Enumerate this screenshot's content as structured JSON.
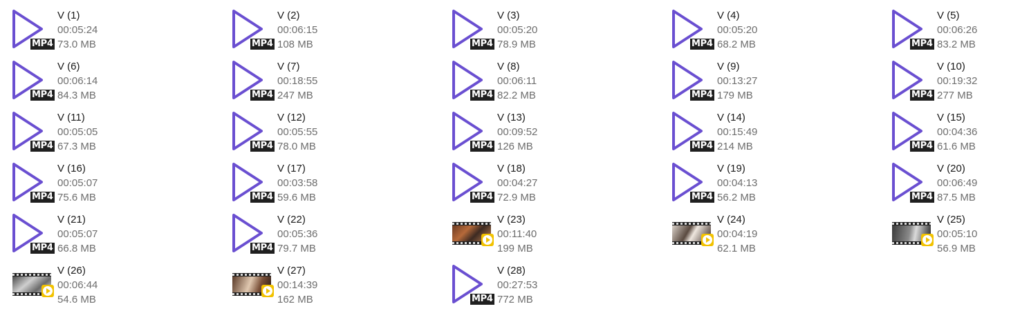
{
  "theme": {
    "mp4_icon_color": "#6a4fd1",
    "badge_background": "#1f1f1f",
    "play_badge_color": "#f2c200",
    "name_color": "#1a1a1a",
    "detail_color": "#6d6d6d"
  },
  "files": [
    {
      "name": "V (1)",
      "duration": "00:05:24",
      "size": "73.0 MB",
      "icon": "mp4-play-icon",
      "badge": "MP4"
    },
    {
      "name": "V (2)",
      "duration": "00:06:15",
      "size": "108 MB",
      "icon": "mp4-play-icon",
      "badge": "MP4"
    },
    {
      "name": "V (3)",
      "duration": "00:05:20",
      "size": "78.9 MB",
      "icon": "mp4-play-icon",
      "badge": "MP4"
    },
    {
      "name": "V (4)",
      "duration": "00:05:20",
      "size": "68.2 MB",
      "icon": "mp4-play-icon",
      "badge": "MP4"
    },
    {
      "name": "V (5)",
      "duration": "00:06:26",
      "size": "83.2 MB",
      "icon": "mp4-play-icon",
      "badge": "MP4"
    },
    {
      "name": "V (6)",
      "duration": "00:06:14",
      "size": "84.3 MB",
      "icon": "mp4-play-icon",
      "badge": "MP4"
    },
    {
      "name": "V (7)",
      "duration": "00:18:55",
      "size": "247 MB",
      "icon": "mp4-play-icon",
      "badge": "MP4"
    },
    {
      "name": "V (8)",
      "duration": "00:06:11",
      "size": "82.2 MB",
      "icon": "mp4-play-icon",
      "badge": "MP4"
    },
    {
      "name": "V (9)",
      "duration": "00:13:27",
      "size": "179 MB",
      "icon": "mp4-play-icon",
      "badge": "MP4"
    },
    {
      "name": "V (10)",
      "duration": "00:19:32",
      "size": "277 MB",
      "icon": "mp4-play-icon",
      "badge": "MP4"
    },
    {
      "name": "V (11)",
      "duration": "00:05:05",
      "size": "67.3 MB",
      "icon": "mp4-play-icon",
      "badge": "MP4"
    },
    {
      "name": "V (12)",
      "duration": "00:05:55",
      "size": "78.0 MB",
      "icon": "mp4-play-icon",
      "badge": "MP4"
    },
    {
      "name": "V (13)",
      "duration": "00:09:52",
      "size": "126 MB",
      "icon": "mp4-play-icon",
      "badge": "MP4"
    },
    {
      "name": "V (14)",
      "duration": "00:15:49",
      "size": "214 MB",
      "icon": "mp4-play-icon",
      "badge": "MP4"
    },
    {
      "name": "V (15)",
      "duration": "00:04:36",
      "size": "61.6 MB",
      "icon": "mp4-play-icon",
      "badge": "MP4"
    },
    {
      "name": "V (16)",
      "duration": "00:05:07",
      "size": "75.6 MB",
      "icon": "mp4-play-icon",
      "badge": "MP4"
    },
    {
      "name": "V (17)",
      "duration": "00:03:58",
      "size": "59.6 MB",
      "icon": "mp4-play-icon",
      "badge": "MP4"
    },
    {
      "name": "V (18)",
      "duration": "00:04:27",
      "size": "72.9 MB",
      "icon": "mp4-play-icon",
      "badge": "MP4"
    },
    {
      "name": "V (19)",
      "duration": "00:04:13",
      "size": "56.2 MB",
      "icon": "mp4-play-icon",
      "badge": "MP4"
    },
    {
      "name": "V (20)",
      "duration": "00:06:49",
      "size": "87.5 MB",
      "icon": "mp4-play-icon",
      "badge": "MP4"
    },
    {
      "name": "V (21)",
      "duration": "00:05:07",
      "size": "66.8 MB",
      "icon": "mp4-play-icon",
      "badge": "MP4"
    },
    {
      "name": "V (22)",
      "duration": "00:05:36",
      "size": "79.7 MB",
      "icon": "mp4-play-icon",
      "badge": "MP4"
    },
    {
      "name": "V (23)",
      "duration": "00:11:40",
      "size": "199 MB",
      "icon": "video-thumbnail-icon",
      "scene": "scene-a"
    },
    {
      "name": "V (24)",
      "duration": "00:04:19",
      "size": "62.1 MB",
      "icon": "video-thumbnail-icon",
      "scene": "scene-b"
    },
    {
      "name": "V (25)",
      "duration": "00:05:10",
      "size": "56.9 MB",
      "icon": "video-thumbnail-icon",
      "scene": "scene-c"
    },
    {
      "name": "V (26)",
      "duration": "00:06:44",
      "size": "54.6 MB",
      "icon": "video-thumbnail-icon",
      "scene": "scene-d"
    },
    {
      "name": "V (27)",
      "duration": "00:14:39",
      "size": "162 MB",
      "icon": "video-thumbnail-icon",
      "scene": "scene-e"
    },
    {
      "name": "V (28)",
      "duration": "00:27:53",
      "size": "772 MB",
      "icon": "mp4-play-icon",
      "badge": "MP4"
    }
  ]
}
